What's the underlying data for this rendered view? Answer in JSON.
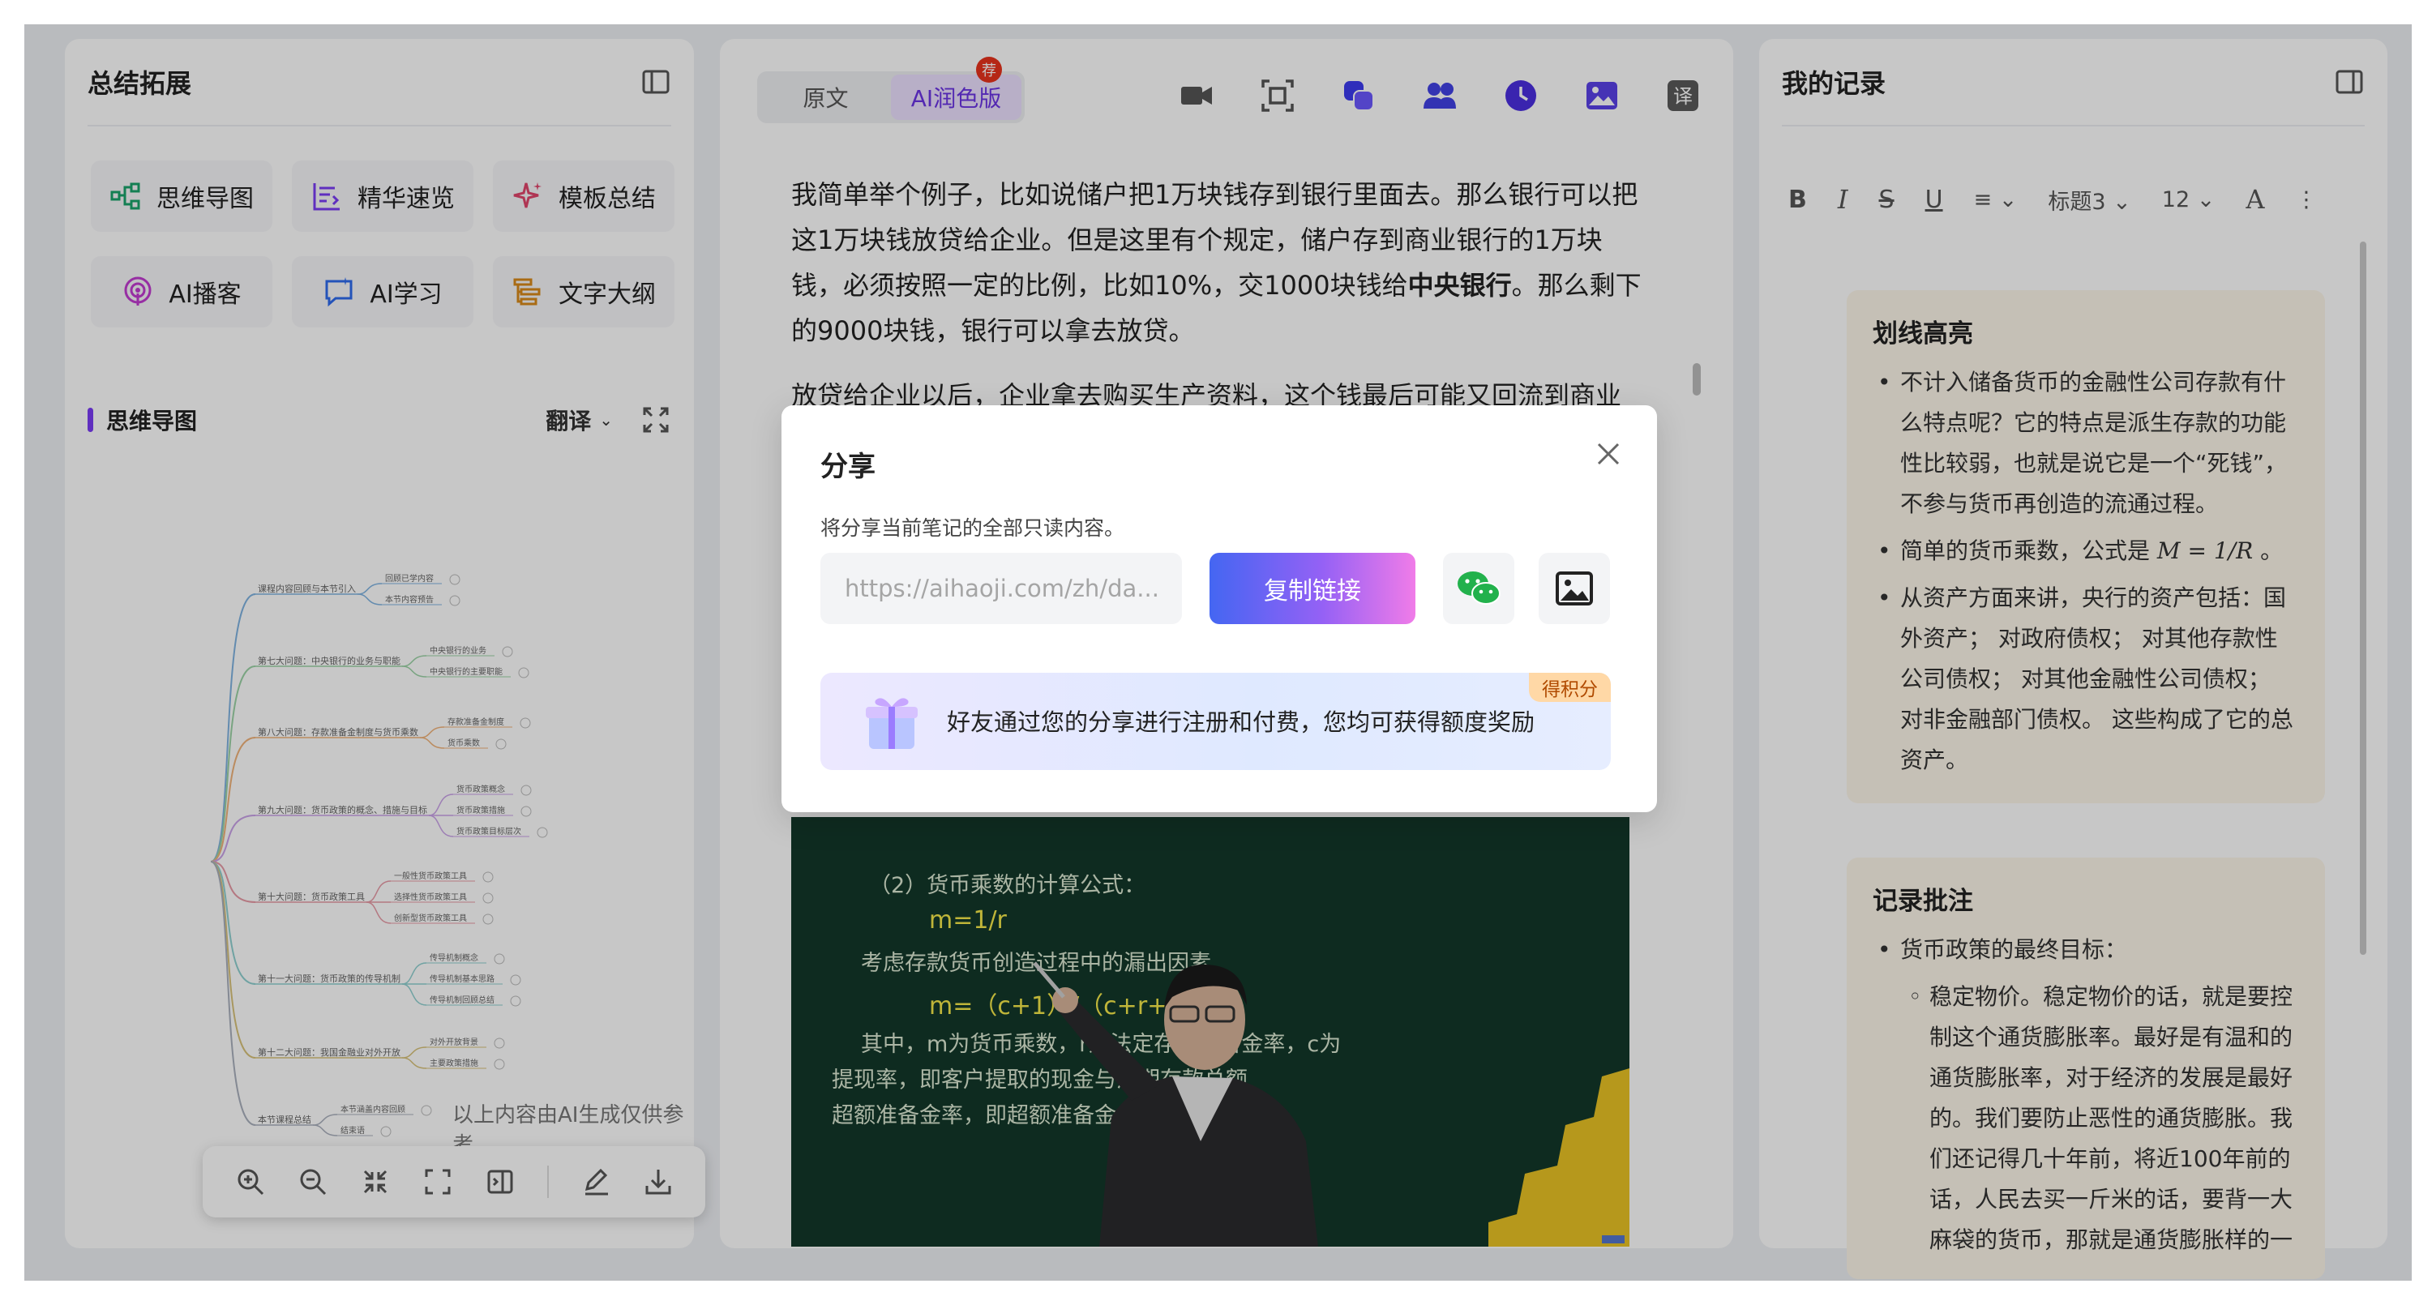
{
  "left_panel": {
    "title": "总结拓展",
    "tools": [
      {
        "label": "思维导图",
        "icon": "mindmap-icon"
      },
      {
        "label": "精华速览",
        "icon": "summary-list-icon"
      },
      {
        "label": "模板总结",
        "icon": "sparkle-icon"
      },
      {
        "label": "AI播客",
        "icon": "podcast-icon"
      },
      {
        "label": "AI学习",
        "icon": "chat-bubble-icon"
      },
      {
        "label": "文字大纲",
        "icon": "outline-icon"
      }
    ],
    "mindmap": {
      "title": "思维导图",
      "translate": "翻译",
      "footnote": "以上内容由AI生成仅供参考",
      "nodes": [
        {
          "label": "课程内容回顾与本节引入",
          "children": [
            "回顾已学内容",
            "本节内容预告"
          ]
        },
        {
          "label": "第七大问题：中央银行的业务与职能",
          "children": [
            "中央银行的业务",
            "中央银行的主要职能"
          ]
        },
        {
          "label": "第八大问题：存款准备金制度与货币乘数",
          "children": [
            "存款准备金制度",
            "货币乘数"
          ]
        },
        {
          "label": "第九大问题：货币政策的概念、措施与目标",
          "children": [
            "货币政策概念",
            "货币政策措施",
            "货币政策目标层次"
          ]
        },
        {
          "label": "第十大问题：货币政策工具",
          "children": [
            "一般性货币政策工具",
            "选择性货币政策工具",
            "创新型货币政策工具"
          ]
        },
        {
          "label": "第十一大问题：货币政策的传导机制",
          "children": [
            "传导机制概念",
            "传导机制基本思路",
            "传导机制回顾总结"
          ]
        },
        {
          "label": "第十二大问题：我国金融业对外开放",
          "children": [
            "对外开放背景",
            "主要政策措施"
          ]
        },
        {
          "label": "本节课程总结",
          "children": [
            "本节涵盖内容回顾",
            "结束语"
          ]
        }
      ]
    }
  },
  "middle_panel": {
    "tabs": [
      {
        "label": "原文",
        "active": false
      },
      {
        "label": "AI润色版",
        "active": true
      }
    ],
    "tab_badge": "荐",
    "toolbar_icons": [
      "video-icon",
      "screenshot-icon",
      "copy-icon",
      "users-icon",
      "clock-icon",
      "image-icon",
      "translate-icon"
    ],
    "paragraphs": [
      {
        "before": "我简单举个例子，比如说储户把1万块钱存到银行里面去。那么银行可以把这1万块钱放贷给企业。但是这里有个规定，储户存到商业银行的1万块钱，必须按照一定的比例，比如10%，交1000块钱给",
        "bold": "中央银行",
        "after": "。那么剩下的9000块钱，银行可以拿去放贷。"
      },
      {
        "before": "放贷给企业以后，企业拿去购买生产资料，这个钱最后可能又回流到商业",
        "bold": "",
        "after": ""
      }
    ],
    "video_board_lines": [
      "（2）货币乘数的计算公式：",
      "m=1/r",
      "考虑存款货币创造过程中的漏出因素",
      "m=（c+1）/（c+r+e）",
      "其中，m为货币乘数，r为法定存款准备金率，c为",
      "提现率，即客户提取的现金与活期存款总额",
      "超额准备金率，即超额准备金与存款总额的"
    ]
  },
  "right_panel": {
    "title": "我的记录",
    "toolbar": {
      "bold": "B",
      "italic": "I",
      "strike": "S",
      "underline": "U",
      "align": "≡",
      "heading": "标题3",
      "size": "12",
      "font": "A",
      "more": "⋮"
    },
    "highlight_card": {
      "title": "划线高亮",
      "items": [
        "不计入储备货币的金融性公司存款有什么特点呢？它的特点是派生存款的功能性比较弱，也就是说它是一个“死钱”，不参与货币再创造的流通过程。",
        "简单的货币乘数，公式是",
        "从资产方面来讲，央行的资产包括：国外资产； 对政府债权； 对其他存款性公司债权； 对其他金融性公司债权； 对非金融部门债权。 这些构成了它的总资产。"
      ],
      "formula": "M = 1/R"
    },
    "annotation_card": {
      "title": "记录批注",
      "items": [
        "货币政策的最终目标："
      ],
      "sub_items": [
        "稳定物价。稳定物价的话，就是要控制这个通货膨胀率。最好是有温和的通货膨胀率，对于经济的发展是最好的。我们要防止恶性的通货膨胀。我们还记得几十年前，将近100年前的话，人民去买一斤米的话，要背一大麻袋的货币，那就是通货膨胀样的一"
      ]
    }
  },
  "dialog": {
    "title": "分享",
    "description": "将分享当前笔记的全部只读内容。",
    "link_placeholder": "https://aihaoji.com/zh/da...",
    "copy_button": "复制链接",
    "promo_text": "好友通过您的分享进行注册和付费，您均可获得额度奖励",
    "promo_badge": "得积分",
    "colors": {
      "wechat": "#22b14c",
      "accent": "#7a3cf5",
      "badge_red": "#e8331d"
    }
  }
}
